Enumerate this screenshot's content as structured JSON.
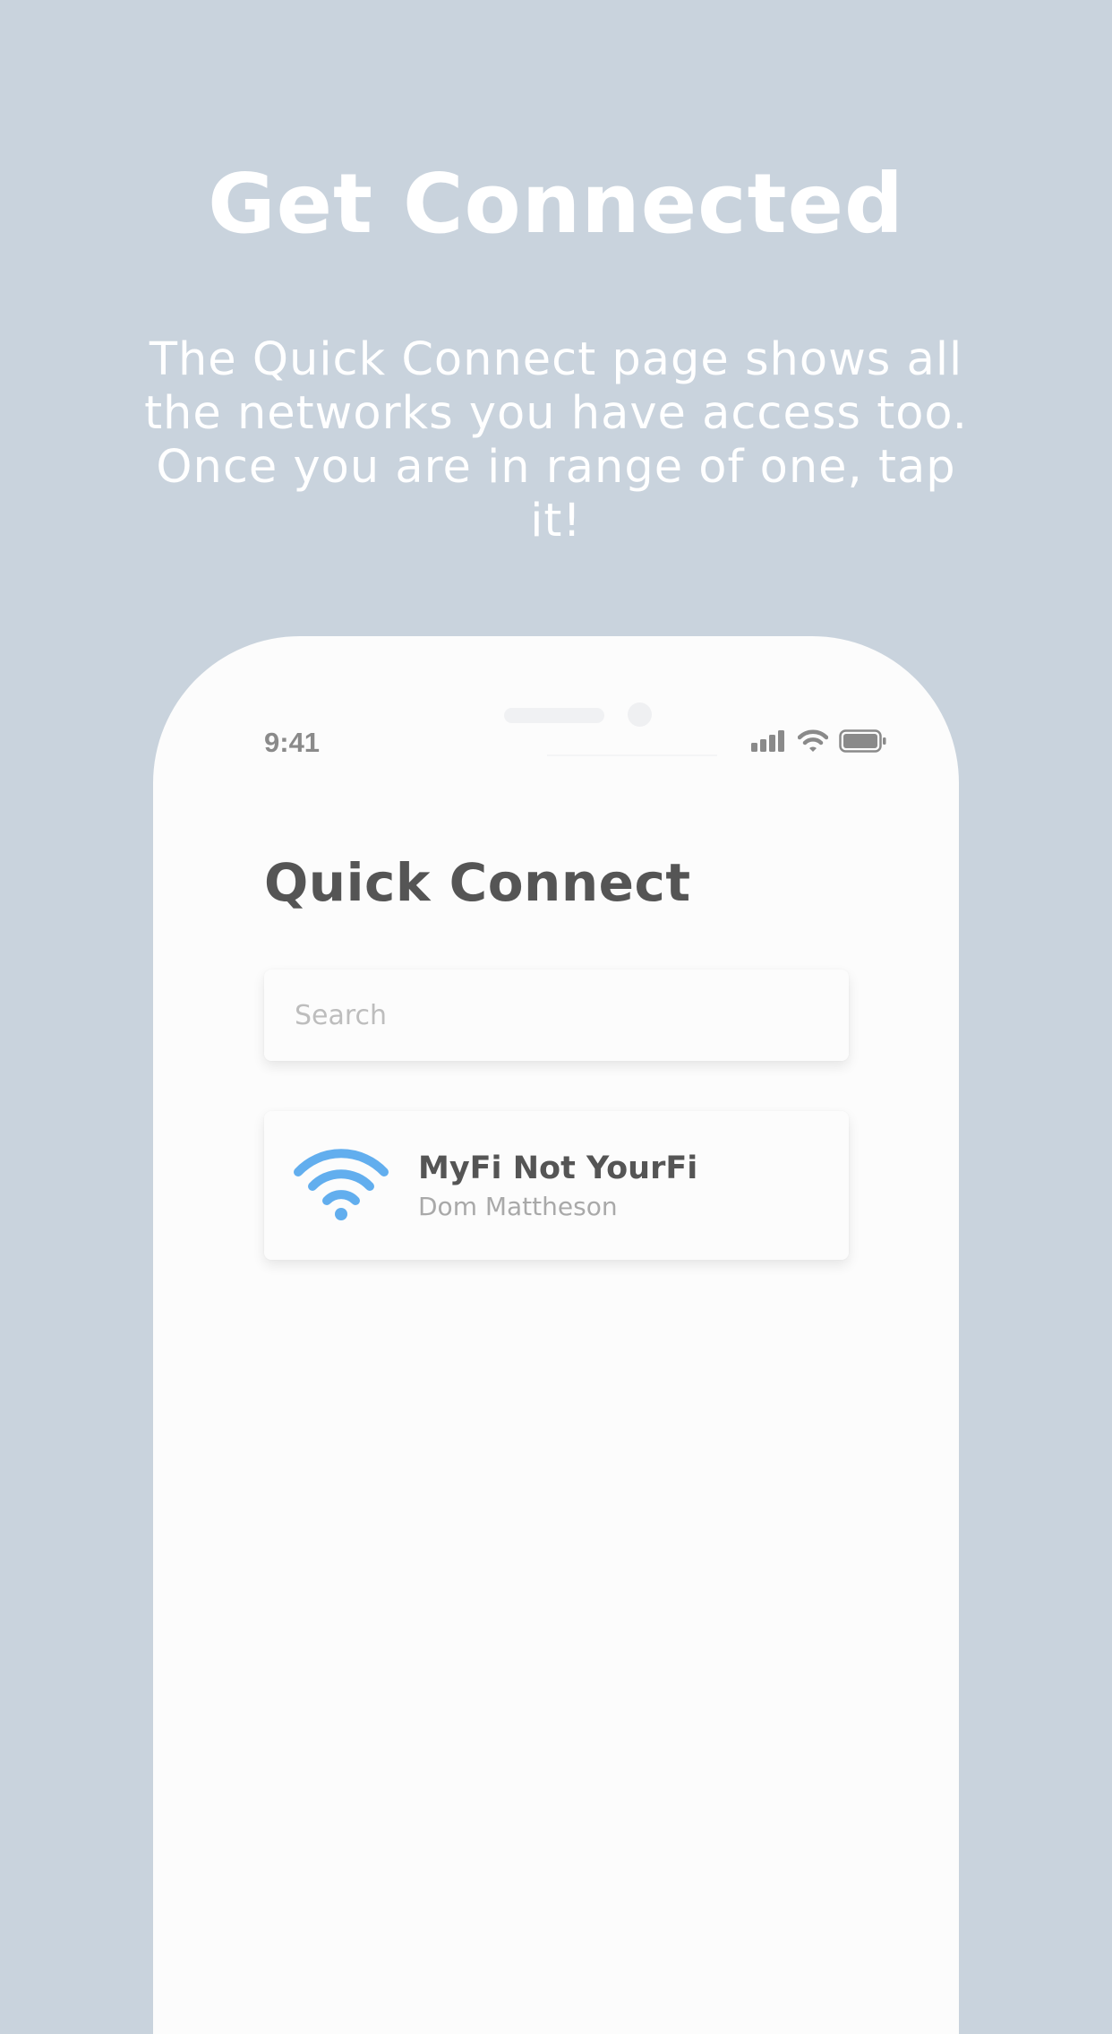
{
  "promo": {
    "headline": "Get Connected",
    "description": "The Quick Connect page shows all the networks you have access too. Once you are in range of one, tap it!"
  },
  "status_bar": {
    "time": "9:41",
    "icons": [
      "cellular-signal-icon",
      "wifi-icon",
      "battery-icon"
    ]
  },
  "screen": {
    "title": "Quick Connect",
    "search": {
      "placeholder": "Search",
      "value": ""
    },
    "networks": [
      {
        "name": "MyFi Not YourFi",
        "owner": "Dom Mattheson",
        "icon": "wifi-icon"
      }
    ]
  },
  "colors": {
    "background": "#c9d3dd",
    "phone": "#fcfcfc",
    "title_text": "#555555",
    "secondary_text": "#a9a9a9",
    "wifi_accent": "#62aeee"
  }
}
